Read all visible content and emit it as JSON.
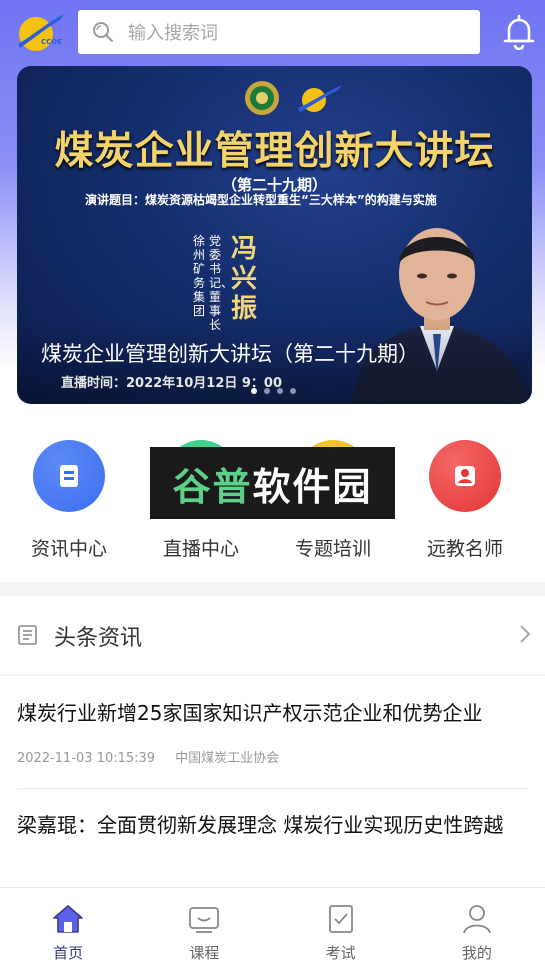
{
  "search": {
    "placeholder": "输入搜索词"
  },
  "banner": {
    "title": "煤炭企业管理创新大讲坛",
    "issue": "（第二十九期）",
    "topic": "演讲题目：煤炭资源枯竭型企业转型重生“三大样本”的构建与实施",
    "org_vertical": "徐州矿务集团",
    "role_vertical": "党委书记、董事长",
    "speaker": "冯兴振",
    "caption": "煤炭企业管理创新大讲坛（第二十九期）",
    "time": "直播时间：2022年10月12日 9：00",
    "slide_count": 4,
    "active_slide": 1
  },
  "entries": [
    {
      "label": "资讯中心",
      "icon": "document-icon",
      "color": "#3c6ef0"
    },
    {
      "label": "直播中心",
      "icon": "live-icon",
      "color": "#3fcf8e"
    },
    {
      "label": "专题培训",
      "icon": "training-icon",
      "color": "#f3c32b"
    },
    {
      "label": "远教名师",
      "icon": "teacher-icon",
      "color": "#ea3a3a"
    }
  ],
  "watermark": {
    "part1": "谷普",
    "part2": "软件园"
  },
  "news": {
    "section_title": "头条资讯",
    "items": [
      {
        "title": "煤炭行业新增25家国家知识产权示范企业和优势企业",
        "date": "2022-11-03 10:15:39",
        "source": "中国煤炭工业协会"
      },
      {
        "title": "梁嘉琨：全面贯彻新发展理念 煤炭行业实现历史性跨越"
      }
    ]
  },
  "tabbar": {
    "items": [
      {
        "label": "首页",
        "icon": "home-icon",
        "active": true
      },
      {
        "label": "课程",
        "icon": "course-icon"
      },
      {
        "label": "考试",
        "icon": "exam-icon"
      },
      {
        "label": "我的",
        "icon": "user-icon"
      }
    ]
  },
  "colors": {
    "accent": "#6f74f2",
    "tab_active": "#3a3a8a"
  }
}
